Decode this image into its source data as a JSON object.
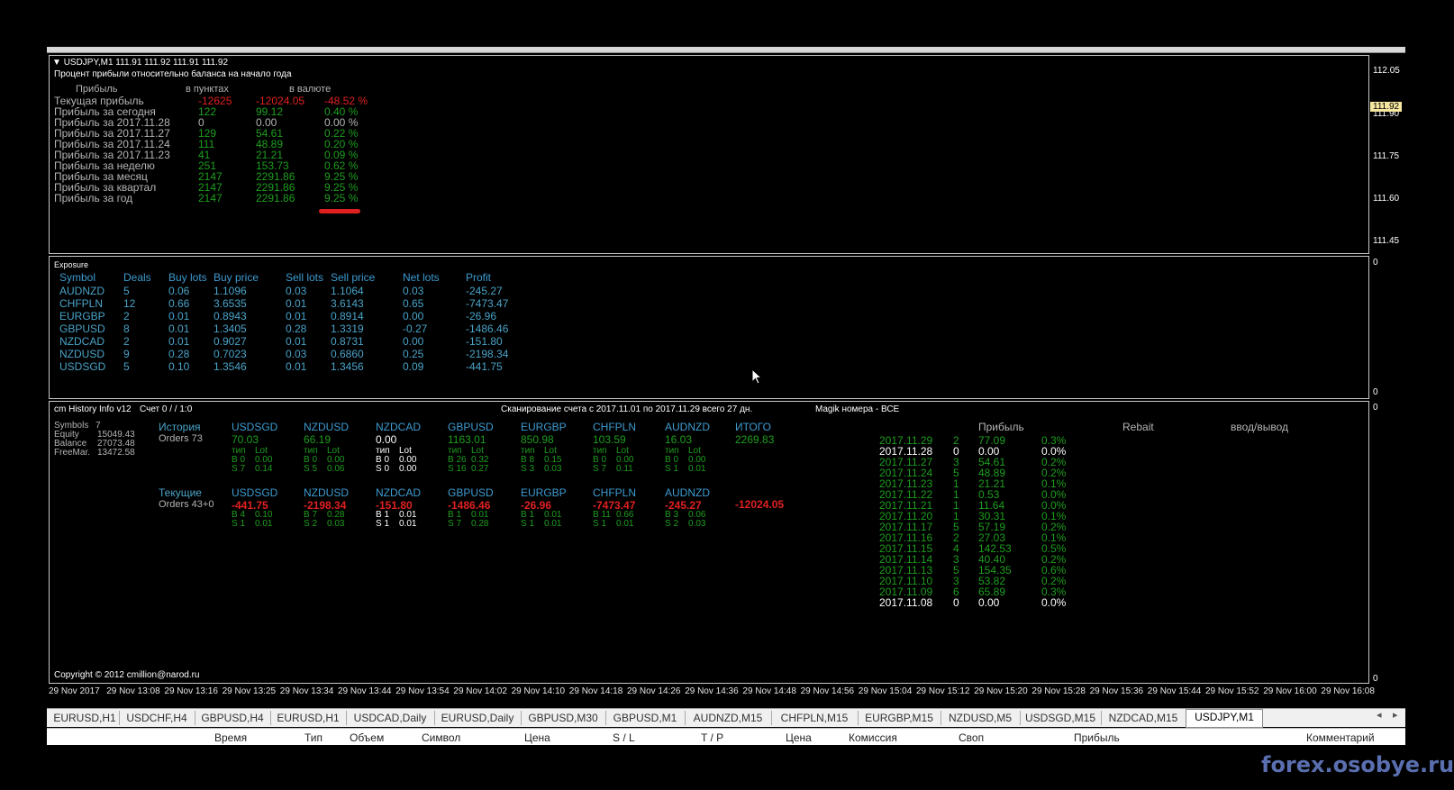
{
  "chart_header": {
    "symbol_line": "USDJPY,M1  111.91 111.92 111.91 111.92",
    "subtitle": "Процент прибыли относительно баланса на начало года"
  },
  "profit_table": {
    "headers": [
      "Прибыль",
      "в пунктах",
      "в валюте"
    ],
    "rows": [
      {
        "label": "Текущая прибыль",
        "points": "-12625",
        "currency": "-12024.05",
        "pct": "-48.52 %",
        "color": "#e02020"
      },
      {
        "label": "Прибыль за сегодня",
        "points": "122",
        "currency": "99.12",
        "pct": "0.40 %",
        "color": "#1e9e1e"
      },
      {
        "label": "Прибыль за 2017.11.28",
        "points": "0",
        "currency": "0.00",
        "pct": "0.00 %",
        "color": "#b4b4b4"
      },
      {
        "label": "Прибыль за 2017.11.27",
        "points": "129",
        "currency": "54.61",
        "pct": "0.22 %",
        "color": "#1e9e1e"
      },
      {
        "label": "Прибыль за 2017.11.24",
        "points": "111",
        "currency": "48.89",
        "pct": "0.20 %",
        "color": "#1e9e1e"
      },
      {
        "label": "Прибыль за 2017.11.23",
        "points": "41",
        "currency": "21.21",
        "pct": "0.09 %",
        "color": "#1e9e1e"
      },
      {
        "label": "Прибыль за неделю",
        "points": "251",
        "currency": "153.73",
        "pct": "0.62 %",
        "color": "#1e9e1e"
      },
      {
        "label": "Прибыль за месяц",
        "points": "2147",
        "currency": "2291.86",
        "pct": "9.25 %",
        "color": "#1e9e1e"
      },
      {
        "label": "Прибыль за квартал",
        "points": "2147",
        "currency": "2291.86",
        "pct": "9.25 %",
        "color": "#1e9e1e"
      },
      {
        "label": "Прибыль за год",
        "points": "2147",
        "currency": "2291.86",
        "pct": "9.25 %",
        "color": "#1e9e1e"
      }
    ]
  },
  "price_scale": [
    "112.05",
    "111.90",
    "111.75",
    "111.60",
    "111.45"
  ],
  "current_price": "111.92",
  "exposure": {
    "title": "Exposure",
    "headers": [
      "Symbol",
      "Deals",
      "Buy lots",
      "Buy price",
      "Sell lots",
      "Sell price",
      "Net lots",
      "Profit"
    ],
    "rows": [
      [
        "AUDNZD",
        "5",
        "0.06",
        "1.1096",
        "0.03",
        "1.1064",
        "0.03",
        "-245.27"
      ],
      [
        "CHFPLN",
        "12",
        "0.66",
        "3.6535",
        "0.01",
        "3.6143",
        "0.65",
        "-7473.47"
      ],
      [
        "EURGBP",
        "2",
        "0.01",
        "0.8943",
        "0.01",
        "0.8914",
        "0.00",
        "-26.96"
      ],
      [
        "GBPUSD",
        "8",
        "0.01",
        "1.3405",
        "0.28",
        "1.3319",
        "-0.27",
        "-1486.46"
      ],
      [
        "NZDCAD",
        "2",
        "0.01",
        "0.9027",
        "0.01",
        "0.8731",
        "0.00",
        "-151.80"
      ],
      [
        "NZDUSD",
        "9",
        "0.28",
        "0.7023",
        "0.03",
        "0.6860",
        "0.25",
        "-2198.34"
      ],
      [
        "USDSGD",
        "5",
        "0.10",
        "1.3546",
        "0.01",
        "1.3456",
        "0.09",
        "-441.75"
      ]
    ],
    "scale_top": "0",
    "scale_bottom": "0"
  },
  "history": {
    "title": "cm History Info v12",
    "account": "Счет 0 /  / 1:0",
    "scan": "Сканирование счета с 2017.11.01 по 2017.11.29 всего 27 дн.",
    "magic": "Magik номера - ВСЕ",
    "account_info": [
      {
        "k": "Symbols",
        "v": "7"
      },
      {
        "k": "Equity",
        "v": "15049.43"
      },
      {
        "k": "Balance",
        "v": "27073.48"
      },
      {
        "k": "FreeMar.",
        "v": "13472.58"
      }
    ],
    "history_label": "История",
    "history_orders": "Orders 73",
    "history_cols": [
      {
        "sym": "USDSGD",
        "val": "70.03",
        "b": "B 0",
        "bl": "0.00",
        "s": "S 7",
        "sl": "0.14",
        "color": "#1e9e1e"
      },
      {
        "sym": "NZDUSD",
        "val": "66.19",
        "b": "B 0",
        "bl": "0.00",
        "s": "S 5",
        "sl": "0.06",
        "color": "#1e9e1e"
      },
      {
        "sym": "NZDCAD",
        "val": "0.00",
        "b": "B 0",
        "bl": "0.00",
        "s": "S 0",
        "sl": "0.00",
        "color": "#ffffff"
      },
      {
        "sym": "GBPUSD",
        "val": "1163.01",
        "b": "B 26",
        "bl": "0.32",
        "s": "S 16",
        "sl": "0.27",
        "color": "#1e9e1e"
      },
      {
        "sym": "EURGBP",
        "val": "850.98",
        "b": "B 8",
        "bl": "0.15",
        "s": "S 3",
        "sl": "0.03",
        "color": "#1e9e1e"
      },
      {
        "sym": "CHFPLN",
        "val": "103.59",
        "b": "B 0",
        "bl": "0.00",
        "s": "S 7",
        "sl": "0.11",
        "color": "#1e9e1e"
      },
      {
        "sym": "AUDNZD",
        "val": "16.03",
        "b": "B 0",
        "bl": "0.00",
        "s": "S 1",
        "sl": "0.01",
        "color": "#1e9e1e"
      }
    ],
    "itogo_label": "ИТОГО",
    "itogo_history": "2269.83",
    "tip_label": "тип",
    "lot_label": "Lot",
    "current_label": "Текущие",
    "current_orders": "Orders 43+0",
    "current_cols": [
      {
        "sym": "USDSGD",
        "val": "-441.75",
        "b": "B 4",
        "bl": "0.10",
        "s": "S 1",
        "sl": "0.01",
        "color": "#e02020",
        "lc": "#1e9e1e"
      },
      {
        "sym": "NZDUSD",
        "val": "-2198.34",
        "b": "B 7",
        "bl": "0.28",
        "s": "S 2",
        "sl": "0.03",
        "color": "#e02020",
        "lc": "#1e9e1e"
      },
      {
        "sym": "NZDCAD",
        "val": "-151.80",
        "b": "B 1",
        "bl": "0.01",
        "s": "S 1",
        "sl": "0.01",
        "color": "#e02020",
        "lc": "#ffffff"
      },
      {
        "sym": "GBPUSD",
        "val": "-1486.46",
        "b": "B 1",
        "bl": "0.01",
        "s": "S 7",
        "sl": "0.28",
        "color": "#e02020",
        "lc": "#1e9e1e"
      },
      {
        "sym": "EURGBP",
        "val": "-26.96",
        "b": "B 1",
        "bl": "0.01",
        "s": "S 1",
        "sl": "0.01",
        "color": "#e02020",
        "lc": "#1e9e1e"
      },
      {
        "sym": "CHFPLN",
        "val": "-7473.47",
        "b": "B 11",
        "bl": "0.66",
        "s": "S 1",
        "sl": "0.01",
        "color": "#e02020",
        "lc": "#1e9e1e"
      },
      {
        "sym": "AUDNZD",
        "val": "-245.27",
        "b": "B 3",
        "bl": "0.06",
        "s": "S 2",
        "sl": "0.03",
        "color": "#e02020",
        "lc": "#1e9e1e"
      }
    ],
    "itogo_current": "-12024.05",
    "daily_headers": [
      "Прибыль",
      "Rebait",
      "ввод/вывод"
    ],
    "daily": [
      {
        "date": "2017.11.29",
        "n": "2",
        "p": "77.09",
        "pct": "0.3%",
        "color": "#1e9e1e"
      },
      {
        "date": "2017.11.28",
        "n": "0",
        "p": "0.00",
        "pct": "0.0%",
        "color": "#ffffff"
      },
      {
        "date": "2017.11.27",
        "n": "3",
        "p": "54.61",
        "pct": "0.2%",
        "color": "#1e9e1e"
      },
      {
        "date": "2017.11.24",
        "n": "5",
        "p": "48.89",
        "pct": "0.2%",
        "color": "#1e9e1e"
      },
      {
        "date": "2017.11.23",
        "n": "1",
        "p": "21.21",
        "pct": "0.1%",
        "color": "#1e9e1e"
      },
      {
        "date": "2017.11.22",
        "n": "1",
        "p": "0.53",
        "pct": "0.0%",
        "color": "#1e9e1e"
      },
      {
        "date": "2017.11.21",
        "n": "1",
        "p": "11.64",
        "pct": "0.0%",
        "color": "#1e9e1e"
      },
      {
        "date": "2017.11.20",
        "n": "1",
        "p": "30.31",
        "pct": "0.1%",
        "color": "#1e9e1e"
      },
      {
        "date": "2017.11.17",
        "n": "5",
        "p": "57.19",
        "pct": "0.2%",
        "color": "#1e9e1e"
      },
      {
        "date": "2017.11.16",
        "n": "2",
        "p": "27.03",
        "pct": "0.1%",
        "color": "#1e9e1e"
      },
      {
        "date": "2017.11.15",
        "n": "4",
        "p": "142.53",
        "pct": "0.5%",
        "color": "#1e9e1e"
      },
      {
        "date": "2017.11.14",
        "n": "3",
        "p": "40.40",
        "pct": "0.2%",
        "color": "#1e9e1e"
      },
      {
        "date": "2017.11.13",
        "n": "5",
        "p": "154.35",
        "pct": "0.6%",
        "color": "#1e9e1e"
      },
      {
        "date": "2017.11.10",
        "n": "3",
        "p": "53.82",
        "pct": "0.2%",
        "color": "#1e9e1e"
      },
      {
        "date": "2017.11.09",
        "n": "6",
        "p": "65.89",
        "pct": "0.3%",
        "color": "#1e9e1e"
      },
      {
        "date": "2017.11.08",
        "n": "0",
        "p": "0.00",
        "pct": "0.0%",
        "color": "#ffffff"
      }
    ],
    "copyright": "Copyright © 2012 cmillion@narod.ru",
    "scale_top": "0",
    "scale_bottom": "0"
  },
  "time_axis": [
    "29 Nov 2017",
    "29 Nov 13:08",
    "29 Nov 13:16",
    "29 Nov 13:25",
    "29 Nov 13:34",
    "29 Nov 13:44",
    "29 Nov 13:54",
    "29 Nov 14:02",
    "29 Nov 14:10",
    "29 Nov 14:18",
    "29 Nov 14:26",
    "29 Nov 14:36",
    "29 Nov 14:48",
    "29 Nov 14:56",
    "29 Nov 15:04",
    "29 Nov 15:12",
    "29 Nov 15:20",
    "29 Nov 15:28",
    "29 Nov 15:36",
    "29 Nov 15:44",
    "29 Nov 15:52",
    "29 Nov 16:00",
    "29 Nov 16:08"
  ],
  "tabs": [
    "EURUSD,H1",
    "USDCHF,H4",
    "GBPUSD,H4",
    "EURUSD,H1",
    "USDCAD,Daily",
    "EURUSD,Daily",
    "GBPUSD,M30",
    "GBPUSD,M1",
    "AUDNZD,M15",
    "CHFPLN,M15",
    "EURGBP,M15",
    "NZDUSD,M5",
    "USDSGD,M15",
    "NZDCAD,M15",
    "USDJPY,M1"
  ],
  "active_tab": "USDJPY,M1",
  "terminal_columns": [
    "Время",
    "Тип",
    "Объем",
    "Символ",
    "Цена",
    "S / L",
    "T / P",
    "Цена",
    "Комиссия",
    "Своп",
    "Прибыль",
    "Комментарий"
  ],
  "watermark": "forex.osobye.ru"
}
